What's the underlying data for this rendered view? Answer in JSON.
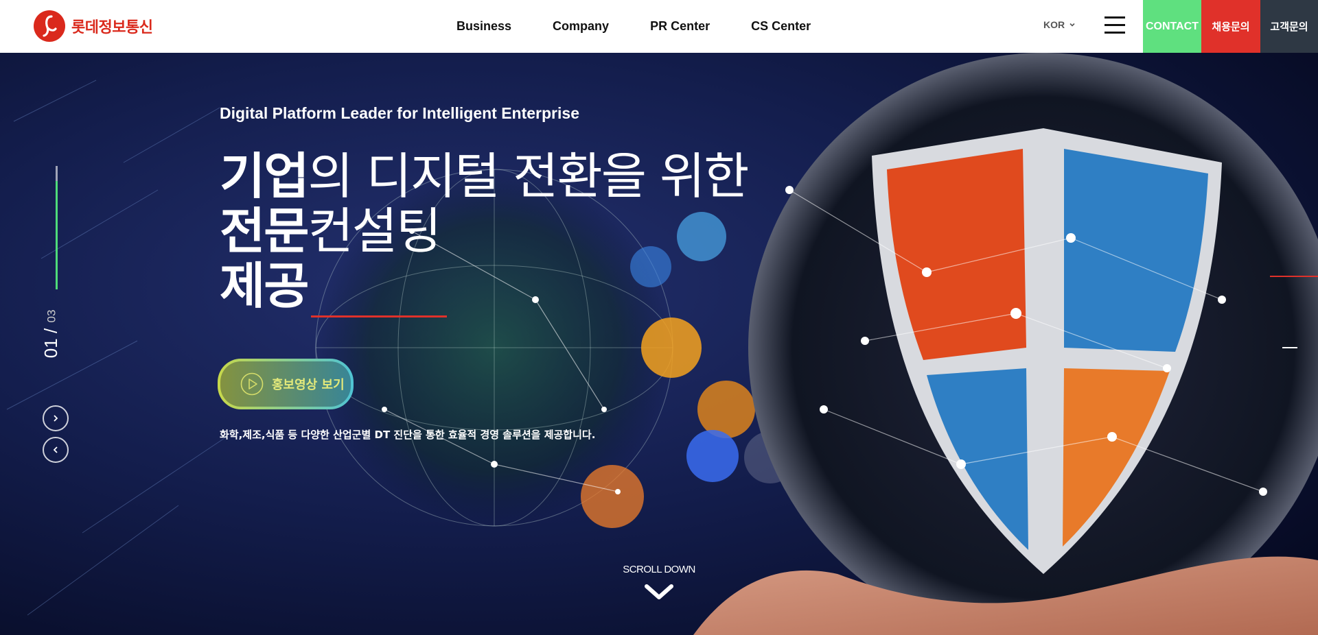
{
  "header": {
    "logo_text": "롯데정보통신",
    "nav": [
      "Business",
      "Company",
      "PR Center",
      "CS Center"
    ],
    "lang": "KOR",
    "buttons": {
      "contact": "CONTACT",
      "recruit": "채용문의",
      "support": "고객문의"
    }
  },
  "hero": {
    "subtitle": "Digital Platform Leader for Intelligent Enterprise",
    "title_line1_bold": "기업",
    "title_line1_light": "의 디지털 전환을 위한",
    "title_line2_bold": "전문",
    "title_line2_light": "컨설팅",
    "title_line3_bold": "제공",
    "promo_button": "홍보영상 보기",
    "description": "화학,제조,식품 등 다양한 산업군별 DT 진단을 통한 효율적 경영 솔루션을 제공합니다.",
    "slide_current": "01 /",
    "slide_total": "03",
    "scroll_down": "SCROLL DOWN"
  },
  "colors": {
    "brand_red": "#da291c",
    "contact_green": "#5fe07f",
    "recruit_red": "#e0312a",
    "support_dark": "#2e3844",
    "pager_green": "#4fdc7a"
  },
  "icons": [
    "logo-icon",
    "chevron-down-icon",
    "hamburger-icon",
    "play-icon",
    "chevron-right-icon",
    "chevron-left-icon",
    "scroll-down-icon"
  ]
}
